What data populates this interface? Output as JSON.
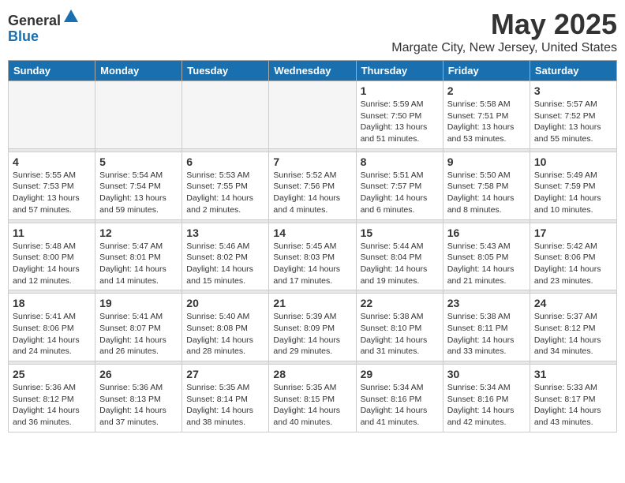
{
  "logo": {
    "general": "General",
    "blue": "Blue"
  },
  "title": "May 2025",
  "subtitle": "Margate City, New Jersey, United States",
  "days_of_week": [
    "Sunday",
    "Monday",
    "Tuesday",
    "Wednesday",
    "Thursday",
    "Friday",
    "Saturday"
  ],
  "weeks": [
    [
      {
        "day": "",
        "info": ""
      },
      {
        "day": "",
        "info": ""
      },
      {
        "day": "",
        "info": ""
      },
      {
        "day": "",
        "info": ""
      },
      {
        "day": "1",
        "info": "Sunrise: 5:59 AM\nSunset: 7:50 PM\nDaylight: 13 hours\nand 51 minutes."
      },
      {
        "day": "2",
        "info": "Sunrise: 5:58 AM\nSunset: 7:51 PM\nDaylight: 13 hours\nand 53 minutes."
      },
      {
        "day": "3",
        "info": "Sunrise: 5:57 AM\nSunset: 7:52 PM\nDaylight: 13 hours\nand 55 minutes."
      }
    ],
    [
      {
        "day": "4",
        "info": "Sunrise: 5:55 AM\nSunset: 7:53 PM\nDaylight: 13 hours\nand 57 minutes."
      },
      {
        "day": "5",
        "info": "Sunrise: 5:54 AM\nSunset: 7:54 PM\nDaylight: 13 hours\nand 59 minutes."
      },
      {
        "day": "6",
        "info": "Sunrise: 5:53 AM\nSunset: 7:55 PM\nDaylight: 14 hours\nand 2 minutes."
      },
      {
        "day": "7",
        "info": "Sunrise: 5:52 AM\nSunset: 7:56 PM\nDaylight: 14 hours\nand 4 minutes."
      },
      {
        "day": "8",
        "info": "Sunrise: 5:51 AM\nSunset: 7:57 PM\nDaylight: 14 hours\nand 6 minutes."
      },
      {
        "day": "9",
        "info": "Sunrise: 5:50 AM\nSunset: 7:58 PM\nDaylight: 14 hours\nand 8 minutes."
      },
      {
        "day": "10",
        "info": "Sunrise: 5:49 AM\nSunset: 7:59 PM\nDaylight: 14 hours\nand 10 minutes."
      }
    ],
    [
      {
        "day": "11",
        "info": "Sunrise: 5:48 AM\nSunset: 8:00 PM\nDaylight: 14 hours\nand 12 minutes."
      },
      {
        "day": "12",
        "info": "Sunrise: 5:47 AM\nSunset: 8:01 PM\nDaylight: 14 hours\nand 14 minutes."
      },
      {
        "day": "13",
        "info": "Sunrise: 5:46 AM\nSunset: 8:02 PM\nDaylight: 14 hours\nand 15 minutes."
      },
      {
        "day": "14",
        "info": "Sunrise: 5:45 AM\nSunset: 8:03 PM\nDaylight: 14 hours\nand 17 minutes."
      },
      {
        "day": "15",
        "info": "Sunrise: 5:44 AM\nSunset: 8:04 PM\nDaylight: 14 hours\nand 19 minutes."
      },
      {
        "day": "16",
        "info": "Sunrise: 5:43 AM\nSunset: 8:05 PM\nDaylight: 14 hours\nand 21 minutes."
      },
      {
        "day": "17",
        "info": "Sunrise: 5:42 AM\nSunset: 8:06 PM\nDaylight: 14 hours\nand 23 minutes."
      }
    ],
    [
      {
        "day": "18",
        "info": "Sunrise: 5:41 AM\nSunset: 8:06 PM\nDaylight: 14 hours\nand 24 minutes."
      },
      {
        "day": "19",
        "info": "Sunrise: 5:41 AM\nSunset: 8:07 PM\nDaylight: 14 hours\nand 26 minutes."
      },
      {
        "day": "20",
        "info": "Sunrise: 5:40 AM\nSunset: 8:08 PM\nDaylight: 14 hours\nand 28 minutes."
      },
      {
        "day": "21",
        "info": "Sunrise: 5:39 AM\nSunset: 8:09 PM\nDaylight: 14 hours\nand 29 minutes."
      },
      {
        "day": "22",
        "info": "Sunrise: 5:38 AM\nSunset: 8:10 PM\nDaylight: 14 hours\nand 31 minutes."
      },
      {
        "day": "23",
        "info": "Sunrise: 5:38 AM\nSunset: 8:11 PM\nDaylight: 14 hours\nand 33 minutes."
      },
      {
        "day": "24",
        "info": "Sunrise: 5:37 AM\nSunset: 8:12 PM\nDaylight: 14 hours\nand 34 minutes."
      }
    ],
    [
      {
        "day": "25",
        "info": "Sunrise: 5:36 AM\nSunset: 8:12 PM\nDaylight: 14 hours\nand 36 minutes."
      },
      {
        "day": "26",
        "info": "Sunrise: 5:36 AM\nSunset: 8:13 PM\nDaylight: 14 hours\nand 37 minutes."
      },
      {
        "day": "27",
        "info": "Sunrise: 5:35 AM\nSunset: 8:14 PM\nDaylight: 14 hours\nand 38 minutes."
      },
      {
        "day": "28",
        "info": "Sunrise: 5:35 AM\nSunset: 8:15 PM\nDaylight: 14 hours\nand 40 minutes."
      },
      {
        "day": "29",
        "info": "Sunrise: 5:34 AM\nSunset: 8:16 PM\nDaylight: 14 hours\nand 41 minutes."
      },
      {
        "day": "30",
        "info": "Sunrise: 5:34 AM\nSunset: 8:16 PM\nDaylight: 14 hours\nand 42 minutes."
      },
      {
        "day": "31",
        "info": "Sunrise: 5:33 AM\nSunset: 8:17 PM\nDaylight: 14 hours\nand 43 minutes."
      }
    ]
  ]
}
